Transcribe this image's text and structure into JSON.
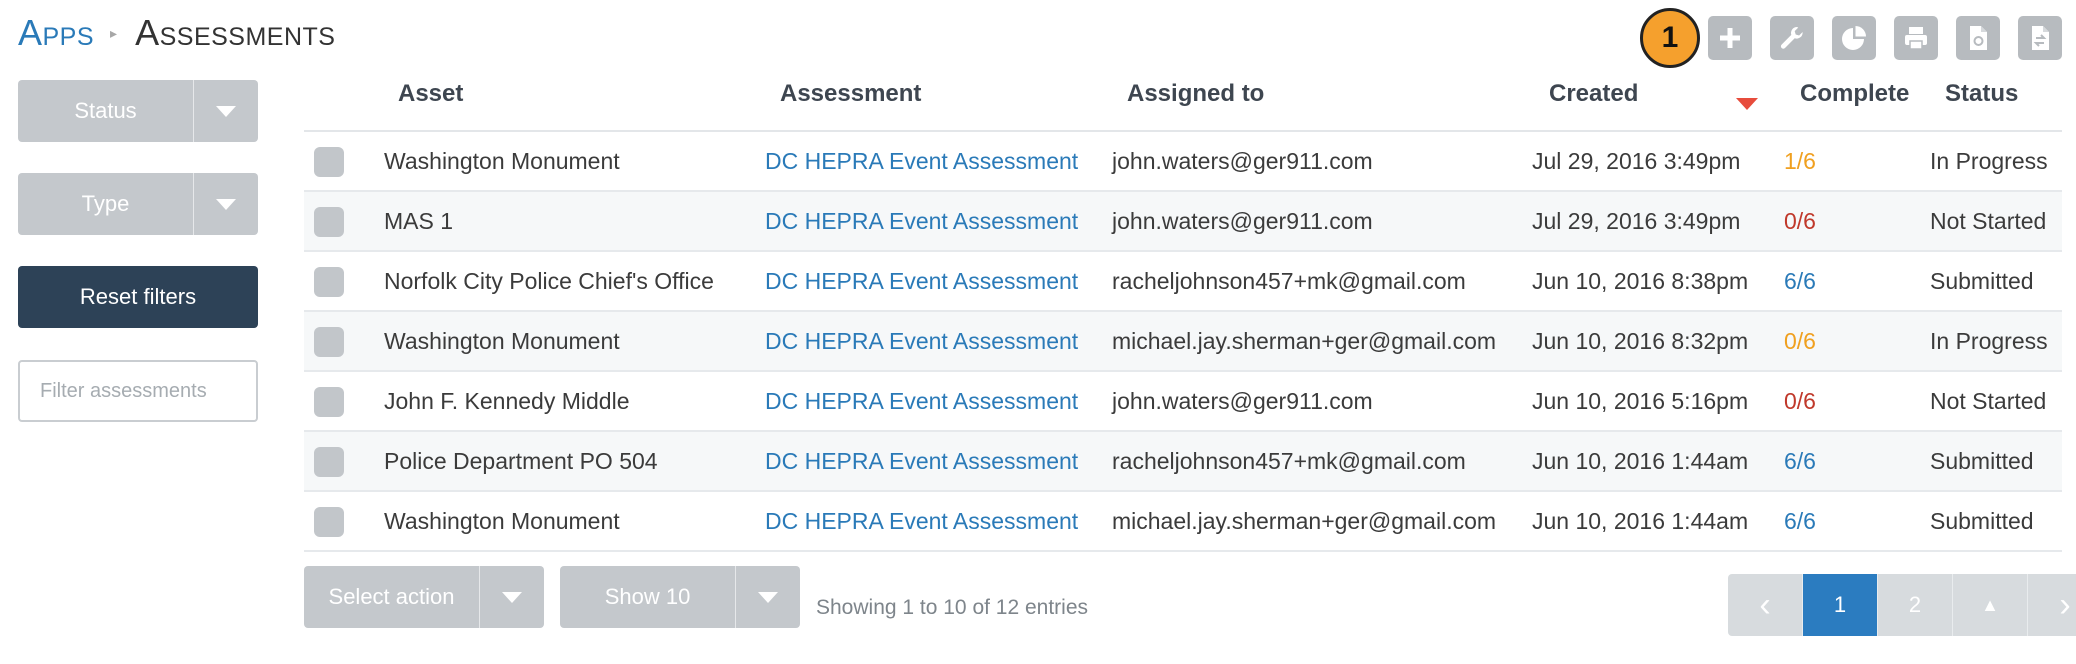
{
  "breadcrumb": {
    "apps": "Apps",
    "separator": "▸",
    "title": "Assessments"
  },
  "step_badge": "1",
  "toolbar": [
    {
      "icon": "plus-icon"
    },
    {
      "icon": "wrench-icon"
    },
    {
      "icon": "pie-chart-icon"
    },
    {
      "icon": "printer-icon"
    },
    {
      "icon": "pdf-file-icon"
    },
    {
      "icon": "export-file-icon"
    }
  ],
  "filters": {
    "status_label": "Status",
    "type_label": "Type",
    "reset_label": "Reset filters",
    "search_placeholder": "Filter assessments"
  },
  "table": {
    "headers": {
      "asset": "Asset",
      "assessment": "Assessment",
      "assigned": "Assigned to",
      "created": "Created",
      "complete": "Complete",
      "status": "Status"
    },
    "sort_column": "Created",
    "rows": [
      {
        "asset": "Washington Monument",
        "assessment": "DC HEPRA Event Assessment",
        "assigned": "john.waters@ger911.com",
        "created": "Jul 29, 2016 3:49pm",
        "complete": "1/6",
        "complete_color": "#f0a020",
        "status": "In Progress"
      },
      {
        "asset": "MAS 1",
        "assessment": "DC HEPRA Event Assessment",
        "assigned": "john.waters@ger911.com",
        "created": "Jul 29, 2016 3:49pm",
        "complete": "0/6",
        "complete_color": "#c0392b",
        "status": "Not Started"
      },
      {
        "asset": "Norfolk City Police Chief's Office",
        "assessment": "DC HEPRA Event Assessment",
        "assigned": "racheljohnson457+mk@gmail.com",
        "created": "Jun 10, 2016 8:38pm",
        "complete": "6/6",
        "complete_color": "#2a7ab8",
        "status": "Submitted"
      },
      {
        "asset": "Washington Monument",
        "assessment": "DC HEPRA Event Assessment",
        "assigned": "michael.jay.sherman+ger@gmail.com",
        "created": "Jun 10, 2016 8:32pm",
        "complete": "0/6",
        "complete_color": "#f0a020",
        "status": "In Progress"
      },
      {
        "asset": "John F. Kennedy Middle",
        "assessment": "DC HEPRA Event Assessment",
        "assigned": "john.waters@ger911.com",
        "created": "Jun 10, 2016 5:16pm",
        "complete": "0/6",
        "complete_color": "#c0392b",
        "status": "Not Started"
      },
      {
        "asset": "Police Department PO 504",
        "assessment": "DC HEPRA Event Assessment",
        "assigned": "racheljohnson457+mk@gmail.com",
        "created": "Jun 10, 2016 1:44am",
        "complete": "6/6",
        "complete_color": "#2a7ab8",
        "status": "Submitted"
      },
      {
        "asset": "Washington Monument",
        "assessment": "DC HEPRA Event Assessment",
        "assigned": "michael.jay.sherman+ger@gmail.com",
        "created": "Jun 10, 2016 1:44am",
        "complete": "6/6",
        "complete_color": "#2a7ab8",
        "status": "Submitted"
      }
    ]
  },
  "footer": {
    "select_action_label": "Select action",
    "show_label": "Show 10",
    "entries_info": "Showing 1 to 10 of 12 entries",
    "pagination": {
      "prev": "‹",
      "pages": [
        "1",
        "2"
      ],
      "active_page": "1",
      "up": "▲",
      "next": "›"
    }
  }
}
